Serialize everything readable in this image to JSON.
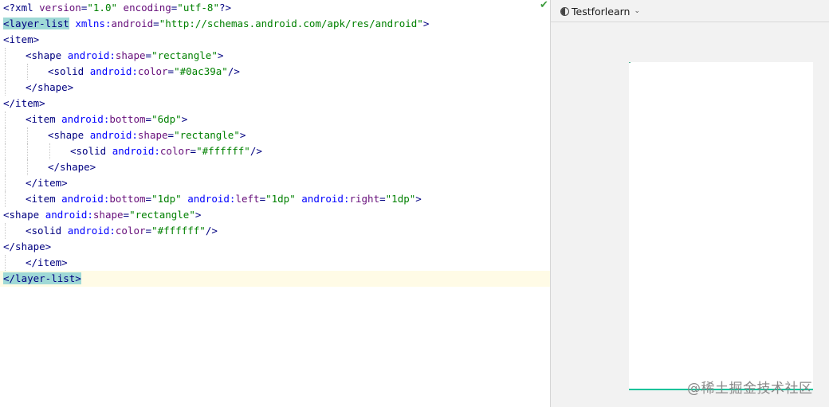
{
  "editor": {
    "lines": [
      {
        "indent": 0,
        "tokens": [
          {
            "t": "tag",
            "v": "<?xml "
          },
          {
            "t": "attr",
            "v": "version"
          },
          {
            "t": "tag",
            "v": "="
          },
          {
            "t": "val",
            "v": "\"1.0\""
          },
          {
            "t": "tag",
            "v": " "
          },
          {
            "t": "attr",
            "v": "encoding"
          },
          {
            "t": "tag",
            "v": "="
          },
          {
            "t": "val",
            "v": "\"utf-8\""
          },
          {
            "t": "tag",
            "v": "?>"
          }
        ]
      },
      {
        "indent": 0,
        "tokens": [
          {
            "t": "tag",
            "v": "<layer-list",
            "hl": true
          },
          {
            "t": "tag",
            "v": " "
          },
          {
            "t": "attrns",
            "v": "xmlns:"
          },
          {
            "t": "attr",
            "v": "android"
          },
          {
            "t": "tag",
            "v": "="
          },
          {
            "t": "val",
            "v": "\"http://schemas.android.com/apk/res/android\""
          },
          {
            "t": "tag",
            "v": ">"
          }
        ]
      },
      {
        "indent": 0,
        "tokens": [
          {
            "t": "tag",
            "v": "<item>"
          }
        ]
      },
      {
        "indent": 1,
        "tokens": [
          {
            "t": "tag",
            "v": "<shape "
          },
          {
            "t": "attrns",
            "v": "android:"
          },
          {
            "t": "attr",
            "v": "shape"
          },
          {
            "t": "tag",
            "v": "="
          },
          {
            "t": "val",
            "v": "\"rectangle\""
          },
          {
            "t": "tag",
            "v": ">"
          }
        ]
      },
      {
        "indent": 2,
        "tokens": [
          {
            "t": "tag",
            "v": "<solid "
          },
          {
            "t": "attrns",
            "v": "android:"
          },
          {
            "t": "attr",
            "v": "color"
          },
          {
            "t": "tag",
            "v": "="
          },
          {
            "t": "val",
            "v": "\"#0ac39a\""
          },
          {
            "t": "tag",
            "v": "/>"
          }
        ]
      },
      {
        "indent": 1,
        "tokens": [
          {
            "t": "tag",
            "v": "</shape>"
          }
        ]
      },
      {
        "indent": 0,
        "tokens": [
          {
            "t": "tag",
            "v": "</item>"
          }
        ]
      },
      {
        "indent": 1,
        "tokens": [
          {
            "t": "tag",
            "v": "<item "
          },
          {
            "t": "attrns",
            "v": "android:"
          },
          {
            "t": "attr",
            "v": "bottom"
          },
          {
            "t": "tag",
            "v": "="
          },
          {
            "t": "val",
            "v": "\"6dp\""
          },
          {
            "t": "tag",
            "v": ">"
          }
        ]
      },
      {
        "indent": 2,
        "tokens": [
          {
            "t": "tag",
            "v": "<shape "
          },
          {
            "t": "attrns",
            "v": "android:"
          },
          {
            "t": "attr",
            "v": "shape"
          },
          {
            "t": "tag",
            "v": "="
          },
          {
            "t": "val",
            "v": "\"rectangle\""
          },
          {
            "t": "tag",
            "v": ">"
          }
        ]
      },
      {
        "indent": 3,
        "tokens": [
          {
            "t": "tag",
            "v": "<solid "
          },
          {
            "t": "attrns",
            "v": "android:"
          },
          {
            "t": "attr",
            "v": "color"
          },
          {
            "t": "tag",
            "v": "="
          },
          {
            "t": "val",
            "v": "\"#ffffff\""
          },
          {
            "t": "tag",
            "v": "/>"
          }
        ]
      },
      {
        "indent": 2,
        "tokens": [
          {
            "t": "tag",
            "v": "</shape>"
          }
        ]
      },
      {
        "indent": 1,
        "tokens": [
          {
            "t": "tag",
            "v": "</item>"
          }
        ]
      },
      {
        "indent": 1,
        "tokens": [
          {
            "t": "tag",
            "v": "<item "
          },
          {
            "t": "attrns",
            "v": "android:"
          },
          {
            "t": "attr",
            "v": "bottom"
          },
          {
            "t": "tag",
            "v": "="
          },
          {
            "t": "val",
            "v": "\"1dp\""
          },
          {
            "t": "tag",
            "v": " "
          },
          {
            "t": "attrns",
            "v": "android:"
          },
          {
            "t": "attr",
            "v": "left"
          },
          {
            "t": "tag",
            "v": "="
          },
          {
            "t": "val",
            "v": "\"1dp\""
          },
          {
            "t": "tag",
            "v": " "
          },
          {
            "t": "attrns",
            "v": "android:"
          },
          {
            "t": "attr",
            "v": "right"
          },
          {
            "t": "tag",
            "v": "="
          },
          {
            "t": "val",
            "v": "\"1dp\""
          },
          {
            "t": "tag",
            "v": ">"
          }
        ]
      },
      {
        "indent": 0,
        "tokens": [
          {
            "t": "tag",
            "v": "<shape "
          },
          {
            "t": "attrns",
            "v": "android:"
          },
          {
            "t": "attr",
            "v": "shape"
          },
          {
            "t": "tag",
            "v": "="
          },
          {
            "t": "val",
            "v": "\"rectangle\""
          },
          {
            "t": "tag",
            "v": ">"
          }
        ]
      },
      {
        "indent": 1,
        "tokens": [
          {
            "t": "tag",
            "v": "<solid "
          },
          {
            "t": "attrns",
            "v": "android:"
          },
          {
            "t": "attr",
            "v": "color"
          },
          {
            "t": "tag",
            "v": "="
          },
          {
            "t": "val",
            "v": "\"#ffffff\""
          },
          {
            "t": "tag",
            "v": "/>"
          }
        ]
      },
      {
        "indent": 0,
        "tokens": [
          {
            "t": "tag",
            "v": "</shape>"
          }
        ]
      },
      {
        "indent": 1,
        "tokens": [
          {
            "t": "tag",
            "v": "</item>"
          }
        ]
      },
      {
        "indent": 0,
        "current": true,
        "tokens": [
          {
            "t": "tag",
            "v": "</layer-list>",
            "hl": true
          }
        ]
      }
    ],
    "status_icon": "checkmark-icon",
    "status_glyph": "✔"
  },
  "preview": {
    "device_label": "Testforlearn",
    "device_icon": "theme-half-circle-icon",
    "dropdown_glyph": "⌄",
    "phone_colors": {
      "background": "#ffffff",
      "border": "#0ac39a"
    }
  },
  "watermark": "@稀土掘金技术社区"
}
